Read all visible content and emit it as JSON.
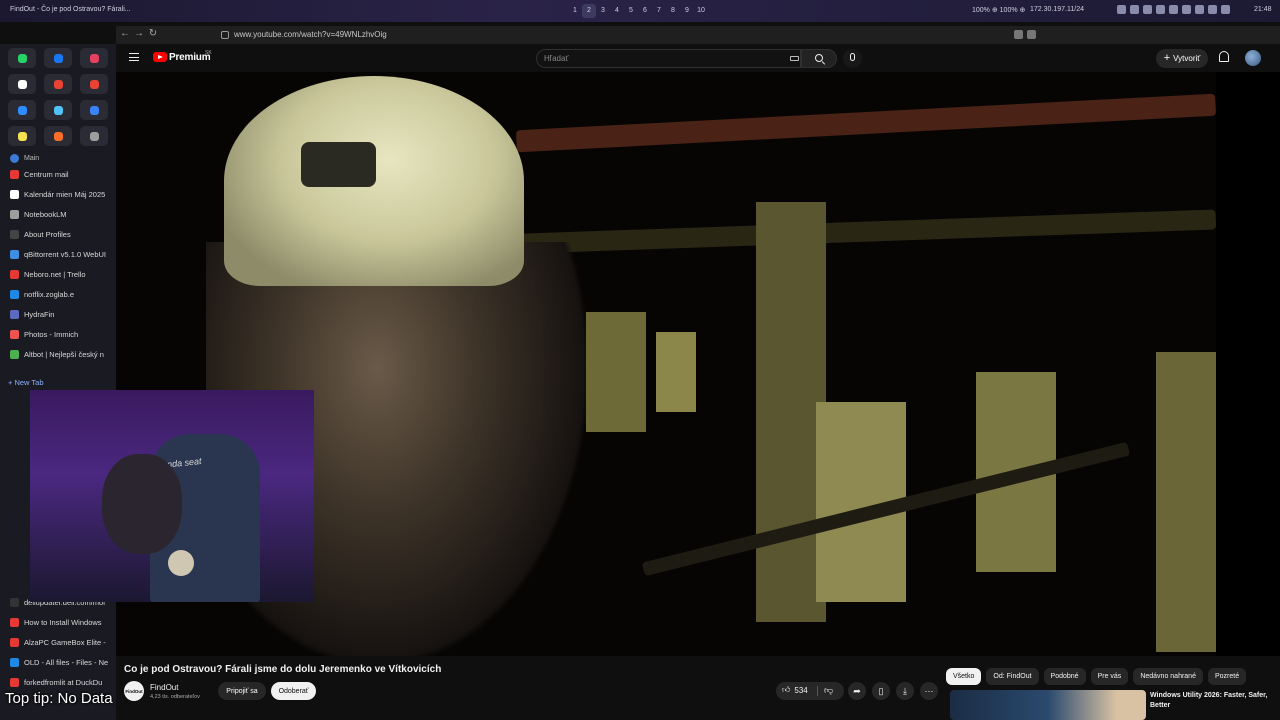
{
  "system_bar": {
    "window_title": "FindOut - Čo je pod Ostravou? Fárali...",
    "workspaces": [
      "1",
      "2",
      "3",
      "4",
      "5",
      "6",
      "7",
      "8",
      "9",
      "10"
    ],
    "active_workspace": "2",
    "stats": "100% ⊕ 100% ⊕",
    "ip": "172.30.197.11/24",
    "clock": "21:48"
  },
  "browser": {
    "url": "www.youtube.com/watch?v=49WNLzhvOig"
  },
  "sidebar": {
    "pinned": [
      {
        "icon": "whatsapp-icon",
        "color": "#25d366"
      },
      {
        "icon": "messenger-icon",
        "color": "#1877f2"
      },
      {
        "icon": "instagram-icon",
        "color": "#e4405f"
      },
      {
        "icon": "x-icon",
        "color": "#ffffff",
        "glyph": "X"
      },
      {
        "icon": "gmail-icon",
        "color": "#ea4335",
        "glyph": "M"
      },
      {
        "icon": "gmail-icon",
        "color": "#ea4335",
        "glyph": "M"
      },
      {
        "icon": "chat-icon",
        "color": "#2d8cff"
      },
      {
        "icon": "cloud-icon",
        "color": "#4fc3f7"
      },
      {
        "icon": "app-icon",
        "color": "#3b82f6"
      },
      {
        "icon": "notes-icon",
        "color": "#f5e050"
      },
      {
        "icon": "gitlab-icon",
        "color": "#fc6d26"
      },
      {
        "icon": "settings-icon",
        "color": "#9e9e9e"
      }
    ],
    "group_label": "Main",
    "tabs": [
      {
        "label": "Centrum mail",
        "color": "#e53935"
      },
      {
        "label": "Kalendár mien Máj 2025",
        "color": "#ffffff"
      },
      {
        "label": "NotebookLM",
        "color": "#9e9e9e"
      },
      {
        "label": "About Profiles",
        "color": "#444444"
      },
      {
        "label": "qBittorrent v5.1.0 WebUI",
        "color": "#3f8de0"
      },
      {
        "label": "Neboro.net | Trello",
        "color": "#e53935"
      },
      {
        "label": "notflix.zoglab.e",
        "color": "#1e88e5"
      },
      {
        "label": "HydraFin",
        "color": "#5c6bc0"
      },
      {
        "label": "Photos - Immich",
        "color": "#ef5350"
      },
      {
        "label": "Altbot | Nejlepší český n",
        "color": "#4caf50"
      }
    ],
    "new_tab": "New Tab",
    "lower_tabs": [
      {
        "label": "dellupdater.dell.com/mor",
        "color": "#333333"
      },
      {
        "label": "How to Install Windows",
        "color": "#e53935"
      },
      {
        "label": "AlzaPC GameBox Elite -",
        "color": "#e53935"
      },
      {
        "label": "OLD - All files - Files - Ne",
        "color": "#1e88e5"
      },
      {
        "label": "forkedfromlit at DuckDu",
        "color": "#e53935"
      }
    ]
  },
  "youtube": {
    "brand": "Premium",
    "brand_sup": "SK",
    "search_placeholder": "Hľadať",
    "create_label": "Vytvoriť",
    "video_title": "Co je pod Ostravou? Fárali jsme do dolu Jeremenko ve Vítkovicích",
    "channel_name": "FindOut",
    "channel_avatar_text": "FindOut",
    "subscribers": "4,23 tis. odberateľov",
    "join_label": "Pripojiť sa",
    "subscribe_label": "Odoberať",
    "likes": "534",
    "chips": [
      "Všetko",
      "Od: FindOut",
      "Podobné",
      "Pre vás",
      "Nedávno nahrané",
      "Pozreté"
    ],
    "active_chip": "Všetko",
    "recommendation_title": "Windows Utility 2026: Faster, Safer, Better"
  },
  "overlay": {
    "webcam_chair_text": "anda seat",
    "top_tip": "Top tip: No Data"
  }
}
